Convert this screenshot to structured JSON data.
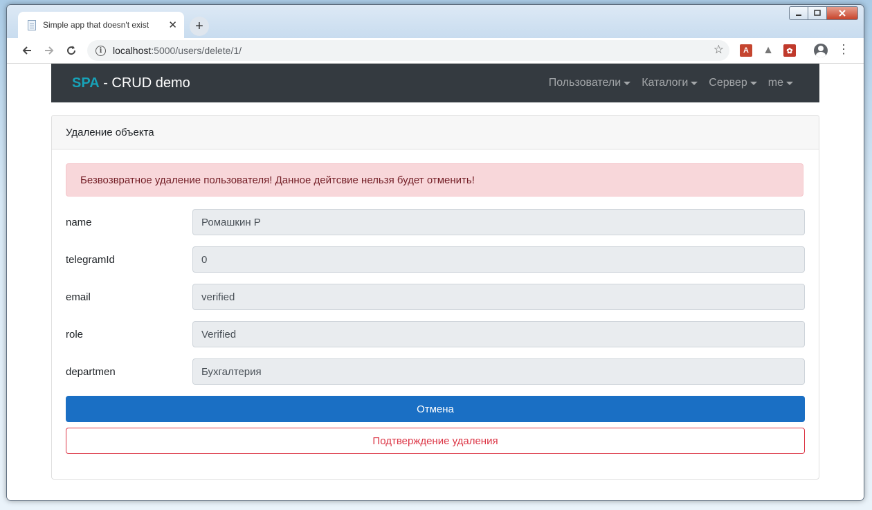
{
  "browser": {
    "tab_title": "Simple app that doesn't exist",
    "tab_close": "✕",
    "new_tab": "+",
    "url_host": "localhost",
    "url_path": ":5000/users/delete/1/"
  },
  "navbar": {
    "brand_spa": "SPA",
    "brand_rest": " - CRUD demo",
    "menu": [
      "Пользователи",
      "Каталоги",
      "Сервер",
      "me"
    ]
  },
  "card": {
    "header": "Удаление объекта",
    "alert": "Безвозвратное удаление пользователя! Данное дейтсвие нельзя будет отменить!",
    "fields": [
      {
        "label": "name",
        "value": "Ромашкин Р"
      },
      {
        "label": "telegramId",
        "value": "0"
      },
      {
        "label": "email",
        "value": "verified"
      },
      {
        "label": "role",
        "value": "Verified"
      },
      {
        "label": "departmen",
        "value": "Бухгалтерия"
      }
    ],
    "cancel_button": "Отмена",
    "confirm_button": "Подтверждение удаления"
  },
  "colors": {
    "navbar_bg": "#343a40",
    "brand_accent": "#17a2b8",
    "primary": "#1a6fc4",
    "danger": "#dc3545",
    "alert_bg": "#f8d7da"
  }
}
